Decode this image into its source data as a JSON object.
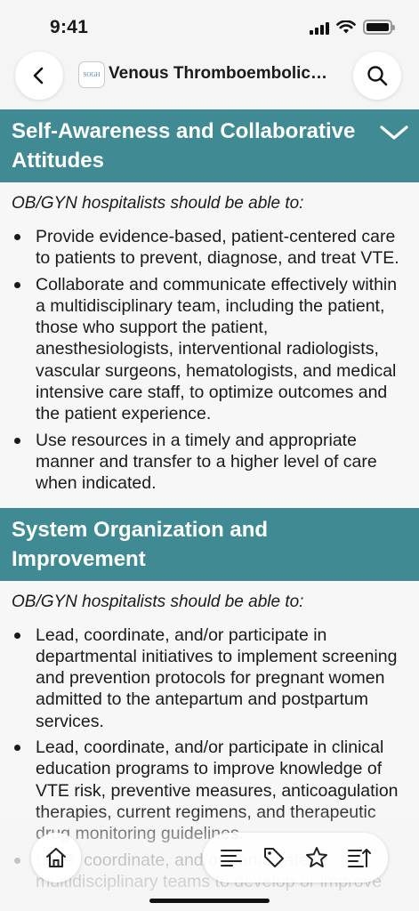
{
  "status_bar": {
    "time": "9:41"
  },
  "nav": {
    "logo_text": "SOGH",
    "title": "Venous Thromboembolic Disease"
  },
  "sections": [
    {
      "title": "Self-Awareness and Collaborative Attitudes",
      "expanded": true,
      "intro": "OB/GYN hospitalists should be able to:",
      "items": [
        "Provide evidence-based, patient-centered care to patients to prevent, diagnose, and treat VTE.",
        "Collaborate and communicate effectively within a multidisciplinary team, including the patient, those who support the patient, anesthesiologists, interventional radiologists, vascular surgeons, hematologists, and medical intensive care staff, to optimize outcomes and the patient experience.",
        "Use resources in a timely and appropriate manner and transfer to a higher level of care when indicated."
      ]
    },
    {
      "title": "System Organization and Improvement",
      "intro": "OB/GYN hospitalists should be able to:",
      "items": [
        "Lead, coordinate, and/or participate in departmental initiatives to implement screening and prevention protocols for pregnant women admitted to the antepartum and postpartum services.",
        "Lead, coordinate, and/or participate in clinical education programs to improve knowledge of VTE risk, preventive measures, anticoagulation therapies, current regimens, and therapeutic drug monitoring guidelines.",
        "Lead, coordinate, and/or participate in multidisciplinary teams to develop or improve"
      ]
    }
  ],
  "icons": {
    "back": "chevron-left-icon",
    "search": "magnifier-icon",
    "collapse": "chevron-down-icon",
    "home": "house-icon",
    "toolbar": [
      "list-icon",
      "tag-icon",
      "star-icon",
      "text-size-icon"
    ]
  },
  "colors": {
    "section_header": "#3f8a93",
    "background": "#f5f5f5"
  }
}
